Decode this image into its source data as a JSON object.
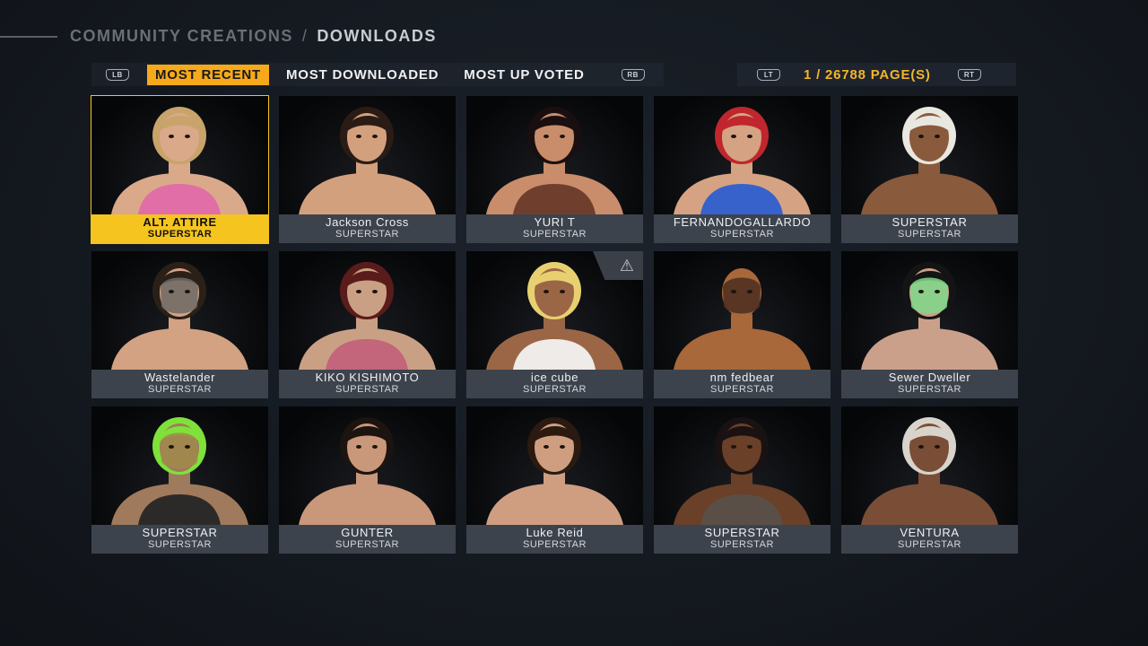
{
  "breadcrumb": {
    "parent": "COMMUNITY CREATIONS",
    "separator": "/",
    "current": "DOWNLOADS"
  },
  "tabs": {
    "left_bumper": "LB",
    "right_bumper": "RB",
    "items": [
      {
        "label": "MOST RECENT",
        "active": true
      },
      {
        "label": "MOST DOWNLOADED",
        "active": false
      },
      {
        "label": "MOST UP VOTED",
        "active": false
      }
    ]
  },
  "pager": {
    "left_trigger": "LT",
    "right_trigger": "RT",
    "text": "1 / 26788 PAGE(S)"
  },
  "cards": [
    {
      "name": "ALT. ATTIRE",
      "type": "SUPERSTAR",
      "selected": true,
      "skin": "#d9a98a",
      "hair": "#c8a36a",
      "outfit": "#e26aa8",
      "mask": ""
    },
    {
      "name": "Jackson Cross",
      "type": "SUPERSTAR",
      "skin": "#d3a07e",
      "hair": "#2a1c14",
      "outfit": "",
      "mask": ""
    },
    {
      "name": "YURI T",
      "type": "SUPERSTAR",
      "skin": "#c98d6c",
      "hair": "#1a0f10",
      "outfit": "#6b3a2a",
      "mask": ""
    },
    {
      "name": "FERNANDOGALLARDO",
      "type": "SUPERSTAR",
      "skin": "#d5a383",
      "hair": "#c0262e",
      "outfit": "#2f5fcf",
      "mask": ""
    },
    {
      "name": "SUPERSTAR",
      "type": "SUPERSTAR",
      "skin": "#8a5a3c",
      "hair": "#e8e8e0",
      "outfit": "",
      "mask": ""
    },
    {
      "name": "Wastelander",
      "type": "SUPERSTAR",
      "skin": "#d2a283",
      "hair": "#2a2018",
      "outfit": "",
      "mask": "#6e6a66"
    },
    {
      "name": "KIKO KISHIMOTO",
      "type": "SUPERSTAR",
      "skin": "#caa084",
      "hair": "#5a1c1a",
      "outfit": "#c2627a",
      "mask": ""
    },
    {
      "name": "ice cube",
      "type": "SUPERSTAR",
      "skin": "#9b6646",
      "hair": "#e8d070",
      "outfit": "#f2f2f2",
      "mask": "",
      "warning": true
    },
    {
      "name": "nm fedbear",
      "type": "SUPERSTAR",
      "skin": "#a8683a",
      "hair": "",
      "outfit": "",
      "mask": "#4a2e20"
    },
    {
      "name": "Sewer Dweller",
      "type": "SUPERSTAR",
      "skin": "#caa08a",
      "hair": "#141414",
      "outfit": "",
      "mask": "#7fd88a"
    },
    {
      "name": "SUPERSTAR",
      "type": "SUPERSTAR",
      "skin": "#a07a5c",
      "hair": "#7ee23a",
      "outfit": "#262626",
      "mask": "#a08a4a"
    },
    {
      "name": "GUNTER",
      "type": "SUPERSTAR",
      "skin": "#c9977a",
      "hair": "#1c1410",
      "outfit": "",
      "mask": ""
    },
    {
      "name": "Luke Reid",
      "type": "SUPERSTAR",
      "skin": "#cf9e80",
      "hair": "#2a1a10",
      "outfit": "",
      "mask": ""
    },
    {
      "name": "SUPERSTAR",
      "type": "SUPERSTAR",
      "skin": "#6a4028",
      "hair": "#1a1212",
      "outfit": "#5a5048",
      "mask": ""
    },
    {
      "name": "VENTURA",
      "type": "SUPERSTAR",
      "skin": "#7a4e36",
      "hair": "#d8d4cc",
      "outfit": "",
      "mask": ""
    }
  ]
}
